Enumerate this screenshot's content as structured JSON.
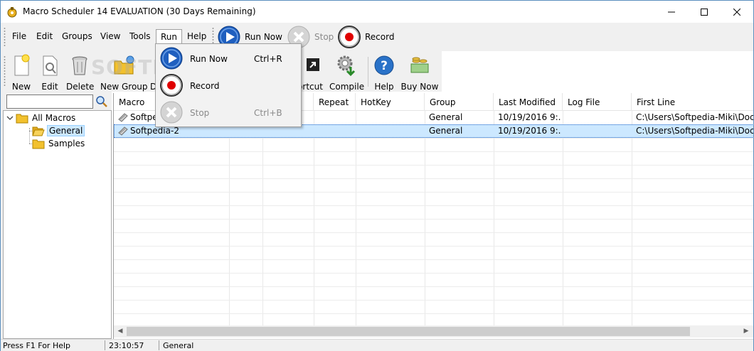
{
  "window": {
    "title": "Macro Scheduler 14 EVALUATION (30 Days Remaining)"
  },
  "menu": {
    "items": [
      "File",
      "Edit",
      "Groups",
      "View",
      "Tools",
      "Run",
      "Help"
    ],
    "open_menu": "Run"
  },
  "quick_actions": {
    "run_now": "Run Now",
    "stop": "Stop",
    "record": "Record"
  },
  "toolbar": {
    "buttons": [
      "New",
      "Edit",
      "Delete",
      "New Group",
      "D",
      "ortcut",
      "Compile",
      "Help",
      "Buy Now"
    ]
  },
  "watermark": "SOFTPEDIA",
  "run_menu": {
    "items": [
      {
        "label": "Run Now",
        "shortcut": "Ctrl+R",
        "enabled": true
      },
      {
        "label": "Record",
        "shortcut": "",
        "enabled": true
      },
      {
        "label": "Stop",
        "shortcut": "Ctrl+B",
        "enabled": false
      }
    ]
  },
  "search": {
    "value": ""
  },
  "tree": {
    "root": "All Macros",
    "children": [
      "General",
      "Samples"
    ],
    "selected": "General"
  },
  "grid": {
    "columns": [
      "Macro",
      "",
      "",
      "Repeat",
      "HotKey",
      "Group",
      "Last Modified",
      "Log File",
      "First Line"
    ],
    "rows": [
      {
        "macro": "Softpe",
        "group": "General",
        "last_modified": "10/19/2016 9:...",
        "log_file": "",
        "first_line": "C:\\Users\\Softpedia-Miki\\Docur"
      },
      {
        "macro": "Softpedia-2",
        "group": "General",
        "last_modified": "10/19/2016 9:...",
        "log_file": "",
        "first_line": "C:\\Users\\Softpedia-Miki\\Docur"
      }
    ]
  },
  "status": {
    "hint": "Press F1 For Help",
    "time": "23:10:57",
    "group": "General"
  },
  "colors": {
    "accent_blue": "#1f5fbf",
    "record_red": "#e00000",
    "selection": "#cce8ff",
    "folder_yellow": "#f2c12e"
  }
}
